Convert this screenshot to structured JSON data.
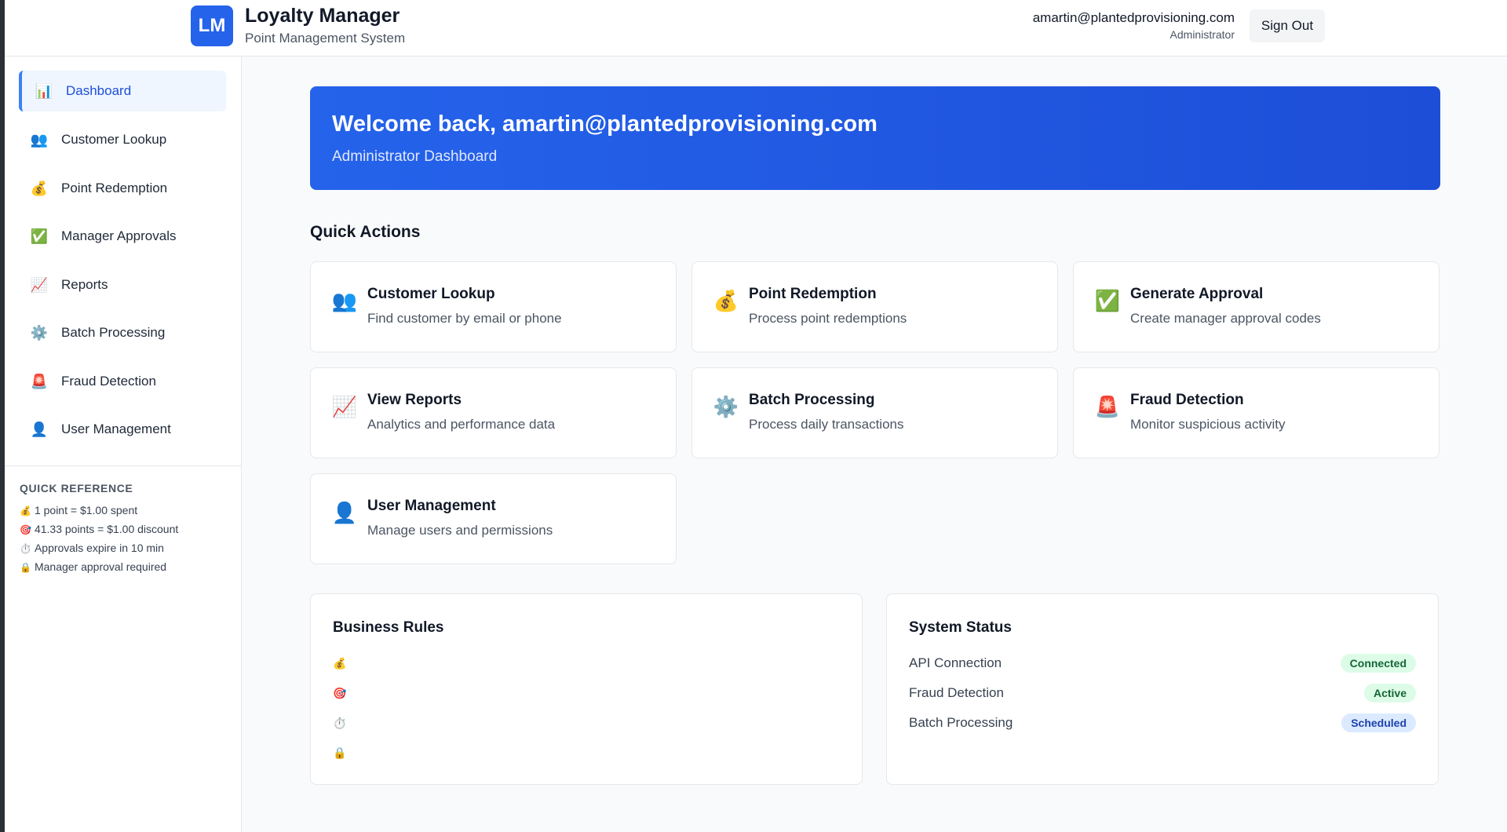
{
  "header": {
    "logo_text": "LM",
    "title": "Loyalty Manager",
    "subtitle": "Point Management System",
    "user_email": "amartin@plantedprovisioning.com",
    "user_role": "Administrator",
    "signout_label": "Sign Out"
  },
  "sidebar": {
    "items": [
      {
        "icon": "📊",
        "label": "Dashboard",
        "active": true
      },
      {
        "icon": "👥",
        "label": "Customer Lookup"
      },
      {
        "icon": "💰",
        "label": "Point Redemption"
      },
      {
        "icon": "✅",
        "label": "Manager Approvals"
      },
      {
        "icon": "📈",
        "label": "Reports"
      },
      {
        "icon": "⚙️",
        "label": "Batch Processing"
      },
      {
        "icon": "🚨",
        "label": "Fraud Detection"
      },
      {
        "icon": "👤",
        "label": "User Management"
      }
    ],
    "quick_reference": {
      "title": "QUICK REFERENCE",
      "items": [
        {
          "icon": "💰",
          "text": "1 point = $1.00 spent"
        },
        {
          "icon": "🎯",
          "text": "41.33 points = $1.00 discount"
        },
        {
          "icon": "⏱️",
          "text": "Approvals expire in 10 min"
        },
        {
          "icon": "🔒",
          "text": "Manager approval required"
        }
      ]
    }
  },
  "welcome": {
    "title": "Welcome back, amartin@plantedprovisioning.com",
    "subtitle": "Administrator Dashboard"
  },
  "quick_actions": {
    "title": "Quick Actions",
    "cards": [
      {
        "icon": "👥",
        "title": "Customer Lookup",
        "desc": "Find customer by email or phone"
      },
      {
        "icon": "💰",
        "title": "Point Redemption",
        "desc": "Process point redemptions"
      },
      {
        "icon": "✅",
        "title": "Generate Approval",
        "desc": "Create manager approval codes"
      },
      {
        "icon": "📈",
        "title": "View Reports",
        "desc": "Analytics and performance data"
      },
      {
        "icon": "⚙️",
        "title": "Batch Processing",
        "desc": "Process daily transactions"
      },
      {
        "icon": "🚨",
        "title": "Fraud Detection",
        "desc": "Monitor suspicious activity"
      },
      {
        "icon": "👤",
        "title": "User Management",
        "desc": "Manage users and permissions"
      }
    ]
  },
  "business_rules": {
    "title": "Business Rules",
    "icons": [
      "💰",
      "🎯",
      "⏱️",
      "🔒"
    ]
  },
  "system_status": {
    "title": "System Status",
    "rows": [
      {
        "label": "API Connection",
        "status": "Connected",
        "color": "#166534"
      },
      {
        "label": "Fraud Detection",
        "status": "Active",
        "color": "#166534"
      },
      {
        "label": "Batch Processing",
        "status": "Scheduled",
        "color": "#1e40af"
      }
    ]
  },
  "colors": {
    "brand": "#2563eb",
    "active_nav_bg": "#eff6ff",
    "success_bg": "#dcfce7",
    "info_bg": "#dbeafe"
  }
}
